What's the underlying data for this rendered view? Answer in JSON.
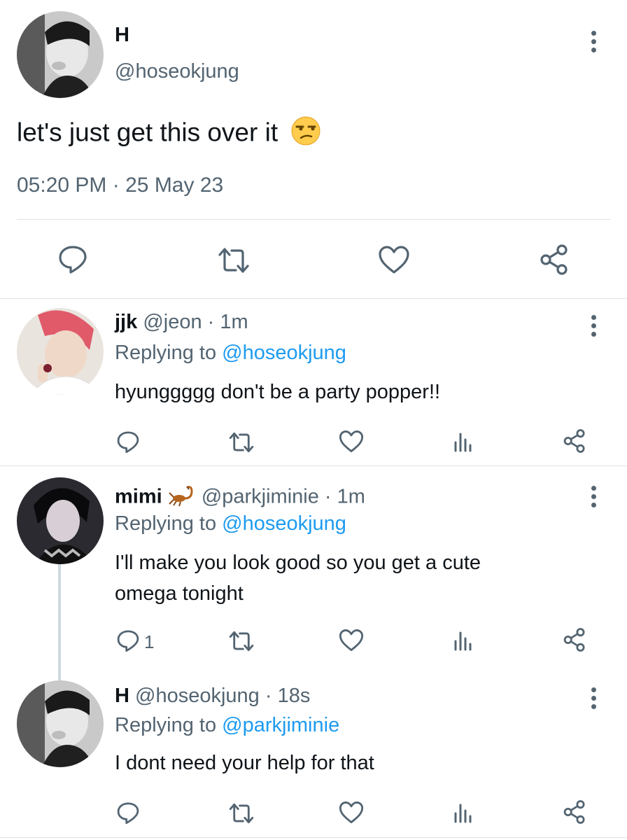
{
  "main_tweet": {
    "name": "H",
    "handle": "@hoseokjung",
    "text": "let's just get this over it",
    "emoji": "😒",
    "time": "05:20 PM",
    "date": "25 May 23",
    "meta_sep": "·"
  },
  "replies": [
    {
      "name": "jjk",
      "handle": "@jeon",
      "sep": "·",
      "time": "1m",
      "replying_prefix": "Replying to",
      "replying_to": "@hoseokjung",
      "text": "hyunggggg don't be a party popper!!",
      "reply_count": ""
    },
    {
      "name": "mimi",
      "name_emoji": "🦂",
      "handle": "@parkjiminie",
      "sep": "·",
      "time": "1m",
      "replying_prefix": "Replying to",
      "replying_to": "@hoseokjung",
      "text_line1": "I'll make you look good so you get a cute",
      "text_line2": "omega tonight",
      "reply_count": "1"
    },
    {
      "name": "H",
      "handle": "@hoseokjung",
      "sep": "·",
      "time": "18s",
      "replying_prefix": "Replying to",
      "replying_to": "@parkjiminie",
      "text": "I dont need your help for that",
      "reply_count": ""
    }
  ],
  "icons": {
    "reply": "reply-icon",
    "retweet": "retweet-icon",
    "like": "heart-icon",
    "views": "views-icon",
    "share": "share-icon",
    "more": "more-icon"
  },
  "colors": {
    "text": "#0f1419",
    "muted": "#536471",
    "link": "#1d9bf0",
    "divider": "#dfe3e7"
  }
}
